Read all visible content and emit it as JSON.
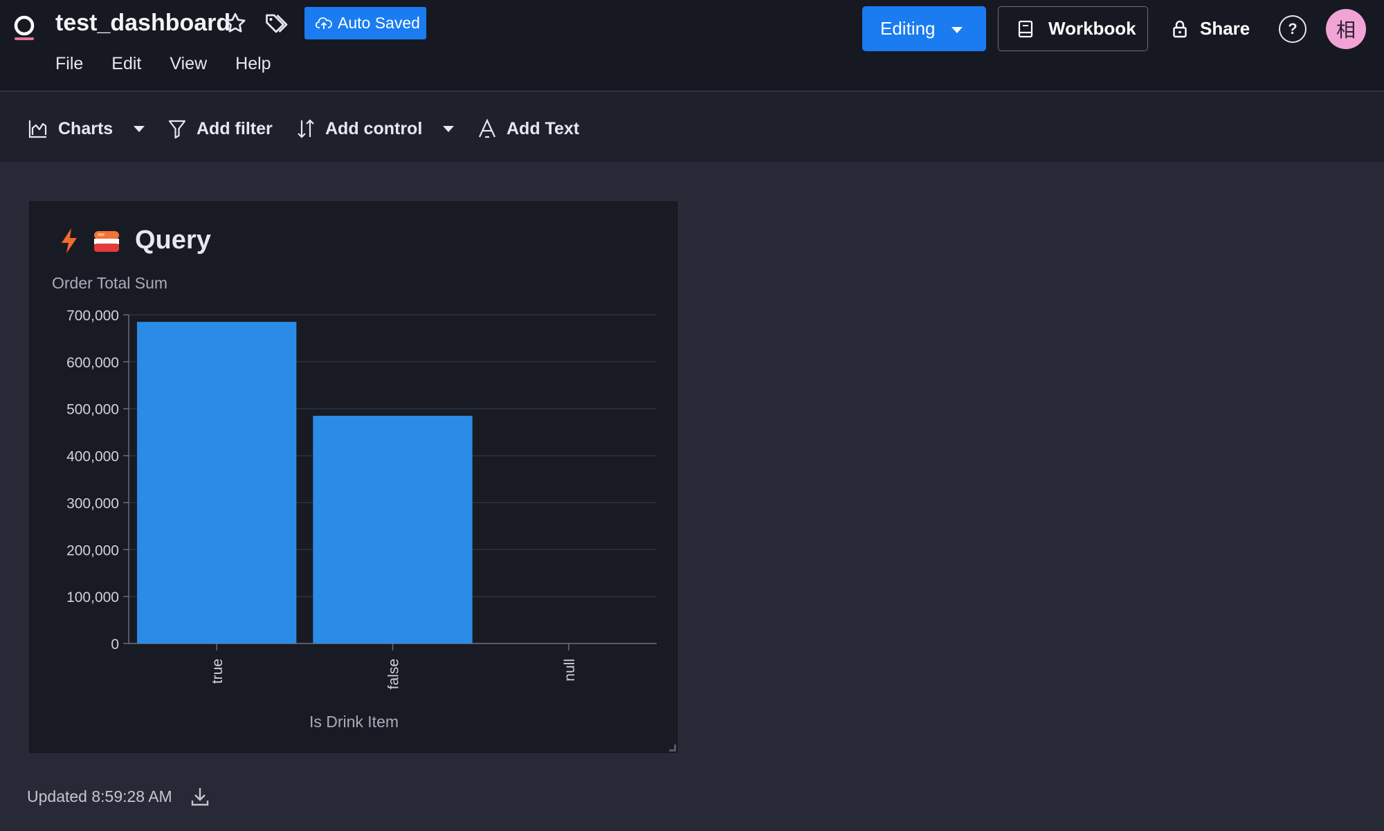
{
  "header": {
    "title": "test_dashboard",
    "auto_saved_label": "Auto Saved",
    "menu": [
      {
        "label": "File"
      },
      {
        "label": "Edit"
      },
      {
        "label": "View"
      },
      {
        "label": "Help"
      }
    ],
    "editing_label": "Editing",
    "workbook_label": "Workbook",
    "share_label": "Share",
    "help_label": "?",
    "avatar_text": "相"
  },
  "toolbar": {
    "charts_label": "Charts",
    "add_filter_label": "Add filter",
    "add_control_label": "Add control",
    "add_text_label": "Add Text"
  },
  "card": {
    "title": "Query"
  },
  "chart_data": {
    "type": "bar",
    "title": "Query",
    "ylabel": "Order Total Sum",
    "xlabel": "Is Drink Item",
    "categories": [
      "true",
      "false",
      "null"
    ],
    "values": [
      685000,
      485000,
      0
    ],
    "ylim": [
      0,
      700000
    ],
    "yticks": [
      0,
      100000,
      200000,
      300000,
      400000,
      500000,
      600000,
      700000
    ],
    "ytick_labels": [
      "0",
      "100,000",
      "200,000",
      "300,000",
      "400,000",
      "500,000",
      "600,000",
      "700,000"
    ],
    "grid": true,
    "bar_color": "#2b8ce8"
  },
  "footer": {
    "updated_text": "Updated 8:59:28 AM"
  },
  "colors": {
    "accent": "#1a7cf0",
    "background": "#272a36",
    "header_bg": "#161922",
    "card_bg": "#181b24",
    "avatar_bg": "#f1a3d6"
  }
}
